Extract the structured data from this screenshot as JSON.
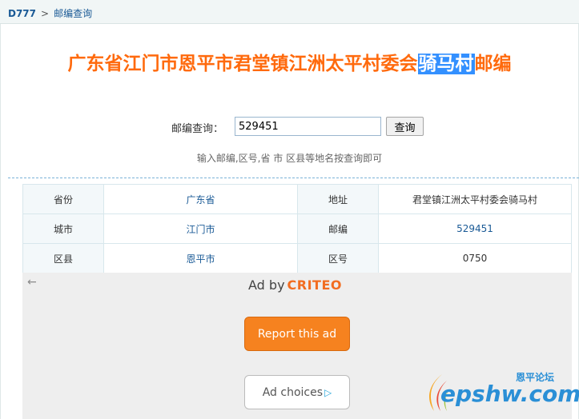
{
  "breadcrumb": {
    "home": "D777",
    "separator": ">",
    "current": "邮编查询"
  },
  "heading": {
    "prefix": "广东省江门市恩平市君堂镇江洲太平村委会",
    "selected": "骑马村",
    "suffix": "邮编"
  },
  "search": {
    "label": "邮编查询：",
    "value": "529451",
    "button": "查询",
    "hint": "输入邮编,区号,省 市 区县等地名按查询即可"
  },
  "table": {
    "row1": {
      "label1": "省份",
      "value1": "广东省",
      "label2": "地址",
      "value2": "君堂镇江洲太平村委会骑马村"
    },
    "row2": {
      "label1": "城市",
      "value1": "江门市",
      "label2": "邮编",
      "value2": "529451"
    },
    "row3": {
      "label1": "区县",
      "value1": "恩平市",
      "label2": "区号",
      "value2": "0750"
    }
  },
  "ad": {
    "back_glyph": "←",
    "by_text": "Ad by",
    "brand": "CRITEO",
    "report": "Report this ad",
    "choices": "Ad choices",
    "choices_icon": "▷"
  },
  "watermark": {
    "text": "epshw.com",
    "cn": "恩平论坛"
  },
  "colors": {
    "title": "#ff6a0d",
    "link": "#1a5a96",
    "ad_button": "#f6821f",
    "selection": "#3390ff"
  }
}
